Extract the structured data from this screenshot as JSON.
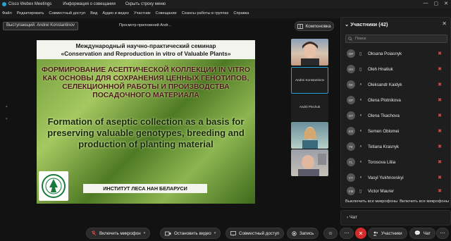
{
  "titlebar": {
    "app_title": "Cisco Webex Meetings",
    "meeting_info": "Информация о совещании",
    "hide_menu": "Скрыть строку меню",
    "minimize": "—",
    "maximize": "▢",
    "close": "✕"
  },
  "menubar": [
    "Файл",
    "Редактировать",
    "Совместный доступ",
    "Вид",
    "Аудио и видео",
    "Участник",
    "Совещание",
    "Сеансы работы в группах",
    "Справка"
  ],
  "speaker": "Выступающий: Andrei Konstantinov",
  "viewer": "Просмотр приложений Andr...",
  "layout_button": "Компоновка",
  "slide": {
    "header_line1": "Международный научно-практический семинар",
    "header_line2": "«Conservation and Reproduction in vitro of Valuable Plants»",
    "title_ru": "ФОРМИРОВАНИЕ АСЕПТИЧЕСКОЙ КОЛЛЕКЦИИ IN VITRO КАК ОСНОВЫ ДЛЯ СОХРАНЕНИЯ ЦЕННЫХ ГЕНОТИПОВ, СЕЛЕКЦИОННОЙ РАБОТЫ И ПРОИЗВОДСТВА ПОСАДОЧНОГО МАТЕРИАЛА",
    "title_en": "Formation of aseptic collection as a basis for preserving valuable genotypes, breeding and production of planting material",
    "institute": "ИНСТИТУТ ЛЕСА НАН БЕЛАРУСИ"
  },
  "thumbnails": [
    {
      "name": ""
    },
    {
      "name": "Andrei Konstantinov"
    },
    {
      "name": "Andrii Pinchuk"
    },
    {
      "name": ""
    },
    {
      "name": ""
    }
  ],
  "participants_panel": {
    "title": "Участники (42)",
    "search_placeholder": "Поиск",
    "mute_all": "Выключить все микрофоны",
    "unmute_all": "Включить все микрофоны",
    "participants": [
      {
        "initials": "OP",
        "name": "Oksana Poiasnyk"
      },
      {
        "initials": "OH",
        "name": "Oleh Hnatiuk"
      },
      {
        "initials": "OK",
        "name": "Oleksandr Kaidyk"
      },
      {
        "initials": "OP",
        "name": "Olena Plotnikova"
      },
      {
        "initials": "OT",
        "name": "Olena Tkachova"
      },
      {
        "initials": "SO",
        "name": "Semen Oblomei"
      },
      {
        "initials": "TK",
        "name": "Tetiana Krasnyk"
      },
      {
        "initials": "TL",
        "name": "Torosova Liliia"
      },
      {
        "initials": "VY",
        "name": "Vasyl Yukhnovskyi"
      },
      {
        "initials": "VM",
        "name": "Victor Maurer"
      }
    ]
  },
  "chat_panel": {
    "title": "Чат"
  },
  "bottombar": {
    "unmute": "Включить микрофон",
    "stop_video": "Остановить видео",
    "share": "Совместный доступ",
    "record": "Запись",
    "participants": "Участники",
    "chat": "Чат"
  },
  "colors": {
    "accent": "#25a4d9",
    "danger": "#d32b2b"
  }
}
